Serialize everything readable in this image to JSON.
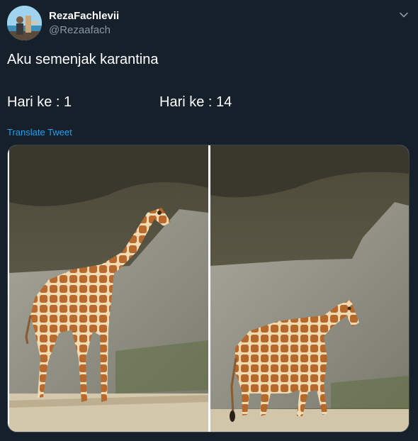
{
  "tweet": {
    "display_name": "RezaFachlevii",
    "handle": "@Rezaafach",
    "text_line1": "Aku semenjak karantina",
    "day_left": "Hari ke : 1",
    "day_right": "Hari ke : 14",
    "translate_label": "Translate Tweet"
  },
  "icons": {
    "caret": "chevron-down-icon"
  },
  "colors": {
    "background": "#15202b",
    "accent": "#1da1f2",
    "secondary_text": "#8899a6"
  }
}
